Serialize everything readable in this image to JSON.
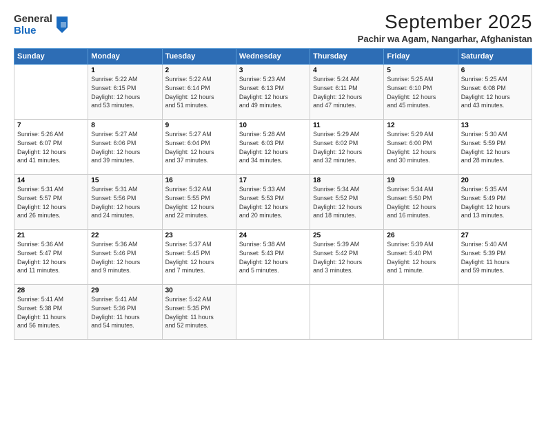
{
  "logo": {
    "line1": "General",
    "line2": "Blue"
  },
  "title": "September 2025",
  "subtitle": "Pachir wa Agam, Nangarhar, Afghanistan",
  "days_of_week": [
    "Sunday",
    "Monday",
    "Tuesday",
    "Wednesday",
    "Thursday",
    "Friday",
    "Saturday"
  ],
  "weeks": [
    [
      {
        "day": "",
        "info": ""
      },
      {
        "day": "1",
        "info": "Sunrise: 5:22 AM\nSunset: 6:15 PM\nDaylight: 12 hours\nand 53 minutes."
      },
      {
        "day": "2",
        "info": "Sunrise: 5:22 AM\nSunset: 6:14 PM\nDaylight: 12 hours\nand 51 minutes."
      },
      {
        "day": "3",
        "info": "Sunrise: 5:23 AM\nSunset: 6:13 PM\nDaylight: 12 hours\nand 49 minutes."
      },
      {
        "day": "4",
        "info": "Sunrise: 5:24 AM\nSunset: 6:11 PM\nDaylight: 12 hours\nand 47 minutes."
      },
      {
        "day": "5",
        "info": "Sunrise: 5:25 AM\nSunset: 6:10 PM\nDaylight: 12 hours\nand 45 minutes."
      },
      {
        "day": "6",
        "info": "Sunrise: 5:25 AM\nSunset: 6:08 PM\nDaylight: 12 hours\nand 43 minutes."
      }
    ],
    [
      {
        "day": "7",
        "info": "Sunrise: 5:26 AM\nSunset: 6:07 PM\nDaylight: 12 hours\nand 41 minutes."
      },
      {
        "day": "8",
        "info": "Sunrise: 5:27 AM\nSunset: 6:06 PM\nDaylight: 12 hours\nand 39 minutes."
      },
      {
        "day": "9",
        "info": "Sunrise: 5:27 AM\nSunset: 6:04 PM\nDaylight: 12 hours\nand 37 minutes."
      },
      {
        "day": "10",
        "info": "Sunrise: 5:28 AM\nSunset: 6:03 PM\nDaylight: 12 hours\nand 34 minutes."
      },
      {
        "day": "11",
        "info": "Sunrise: 5:29 AM\nSunset: 6:02 PM\nDaylight: 12 hours\nand 32 minutes."
      },
      {
        "day": "12",
        "info": "Sunrise: 5:29 AM\nSunset: 6:00 PM\nDaylight: 12 hours\nand 30 minutes."
      },
      {
        "day": "13",
        "info": "Sunrise: 5:30 AM\nSunset: 5:59 PM\nDaylight: 12 hours\nand 28 minutes."
      }
    ],
    [
      {
        "day": "14",
        "info": "Sunrise: 5:31 AM\nSunset: 5:57 PM\nDaylight: 12 hours\nand 26 minutes."
      },
      {
        "day": "15",
        "info": "Sunrise: 5:31 AM\nSunset: 5:56 PM\nDaylight: 12 hours\nand 24 minutes."
      },
      {
        "day": "16",
        "info": "Sunrise: 5:32 AM\nSunset: 5:55 PM\nDaylight: 12 hours\nand 22 minutes."
      },
      {
        "day": "17",
        "info": "Sunrise: 5:33 AM\nSunset: 5:53 PM\nDaylight: 12 hours\nand 20 minutes."
      },
      {
        "day": "18",
        "info": "Sunrise: 5:34 AM\nSunset: 5:52 PM\nDaylight: 12 hours\nand 18 minutes."
      },
      {
        "day": "19",
        "info": "Sunrise: 5:34 AM\nSunset: 5:50 PM\nDaylight: 12 hours\nand 16 minutes."
      },
      {
        "day": "20",
        "info": "Sunrise: 5:35 AM\nSunset: 5:49 PM\nDaylight: 12 hours\nand 13 minutes."
      }
    ],
    [
      {
        "day": "21",
        "info": "Sunrise: 5:36 AM\nSunset: 5:47 PM\nDaylight: 12 hours\nand 11 minutes."
      },
      {
        "day": "22",
        "info": "Sunrise: 5:36 AM\nSunset: 5:46 PM\nDaylight: 12 hours\nand 9 minutes."
      },
      {
        "day": "23",
        "info": "Sunrise: 5:37 AM\nSunset: 5:45 PM\nDaylight: 12 hours\nand 7 minutes."
      },
      {
        "day": "24",
        "info": "Sunrise: 5:38 AM\nSunset: 5:43 PM\nDaylight: 12 hours\nand 5 minutes."
      },
      {
        "day": "25",
        "info": "Sunrise: 5:39 AM\nSunset: 5:42 PM\nDaylight: 12 hours\nand 3 minutes."
      },
      {
        "day": "26",
        "info": "Sunrise: 5:39 AM\nSunset: 5:40 PM\nDaylight: 12 hours\nand 1 minute."
      },
      {
        "day": "27",
        "info": "Sunrise: 5:40 AM\nSunset: 5:39 PM\nDaylight: 11 hours\nand 59 minutes."
      }
    ],
    [
      {
        "day": "28",
        "info": "Sunrise: 5:41 AM\nSunset: 5:38 PM\nDaylight: 11 hours\nand 56 minutes."
      },
      {
        "day": "29",
        "info": "Sunrise: 5:41 AM\nSunset: 5:36 PM\nDaylight: 11 hours\nand 54 minutes."
      },
      {
        "day": "30",
        "info": "Sunrise: 5:42 AM\nSunset: 5:35 PM\nDaylight: 11 hours\nand 52 minutes."
      },
      {
        "day": "",
        "info": ""
      },
      {
        "day": "",
        "info": ""
      },
      {
        "day": "",
        "info": ""
      },
      {
        "day": "",
        "info": ""
      }
    ]
  ]
}
